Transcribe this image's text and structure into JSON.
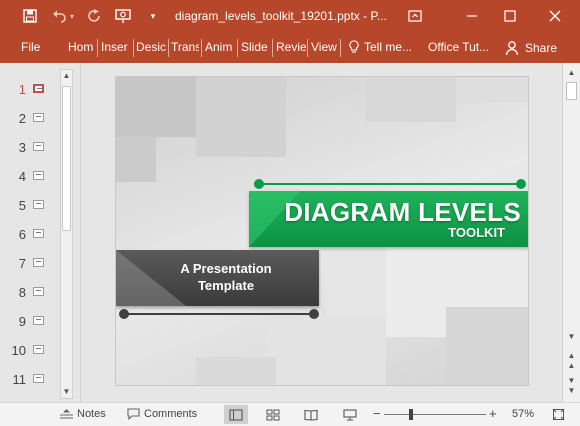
{
  "window": {
    "title": "diagram_levels_toolkit_19201.pptx - P...",
    "controls": [
      "ribbon-display",
      "minimize",
      "maximize",
      "close"
    ]
  },
  "quick_access": {
    "icons": [
      "save-icon",
      "undo-icon",
      "redo-icon",
      "present-icon",
      "customize-icon"
    ]
  },
  "ribbon": {
    "file_label": "File",
    "tabs": [
      "Hom",
      "Inser",
      "Desic",
      "Trans",
      "Anim",
      "Slide",
      "Revie",
      "View"
    ],
    "tell_me": "Tell me...",
    "office_tut": "Office Tut...",
    "share_label": "Share"
  },
  "thumbnails": {
    "selected": "1",
    "numbers": [
      "1",
      "2",
      "3",
      "4",
      "5",
      "6",
      "7",
      "8",
      "9",
      "10",
      "11"
    ]
  },
  "slide": {
    "title": "DIAGRAM LEVELS",
    "subtitle": "TOOLKIT",
    "tagline_line1": "A Presentation",
    "tagline_line2": "Template",
    "accent_green": "#0b9a47",
    "accent_dark": "#3f3f3f"
  },
  "status_bar": {
    "notes_label": "Notes",
    "comments_label": "Comments",
    "zoom_out": "−",
    "zoom_in": "+",
    "zoom": "57%"
  }
}
